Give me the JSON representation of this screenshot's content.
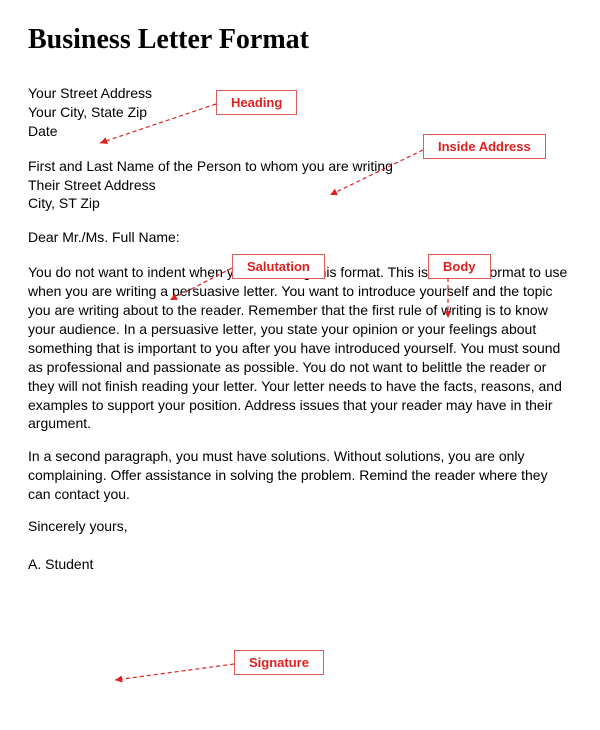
{
  "title": "Business Letter Format",
  "annotations": {
    "heading": "Heading",
    "inside_address": "Inside Address",
    "salutation": "Salutation",
    "body": "Body",
    "signature": "Signature"
  },
  "heading": {
    "line1": "Your Street Address",
    "line2": "Your City, State  Zip",
    "line3": "Date"
  },
  "inside_address": {
    "line1": "First and Last Name of the Person to whom you are writing",
    "line2": "Their Street Address",
    "line3": "City, ST Zip"
  },
  "salutation": "Dear Mr./Ms. Full Name:",
  "body": {
    "p1": "You do not want to indent when you are using this format.  This is the best format to use when you are writing a persuasive letter.   You want to introduce yourself and the topic you are writing about to the reader.  Remember that the first rule of writing is to know your audience.  In a persuasive letter, you state your opinion or your feelings about something that is important to you after you have introduced yourself.  You must sound as professional and passionate as possible.  You do not want to belittle the reader or they will not finish reading your letter.  Your letter needs to have the facts, reasons, and examples to support your position. Address issues that your reader may have in their argument.",
    "p2": "In a second paragraph, you must have solutions.  Without solutions, you are only complaining. Offer assistance in solving the problem.  Remind the reader where they can contact you."
  },
  "closing": "Sincerely yours,",
  "signature": "A. Student",
  "colors": {
    "annotation_border": "#e35a5a",
    "annotation_text": "#e02020"
  }
}
